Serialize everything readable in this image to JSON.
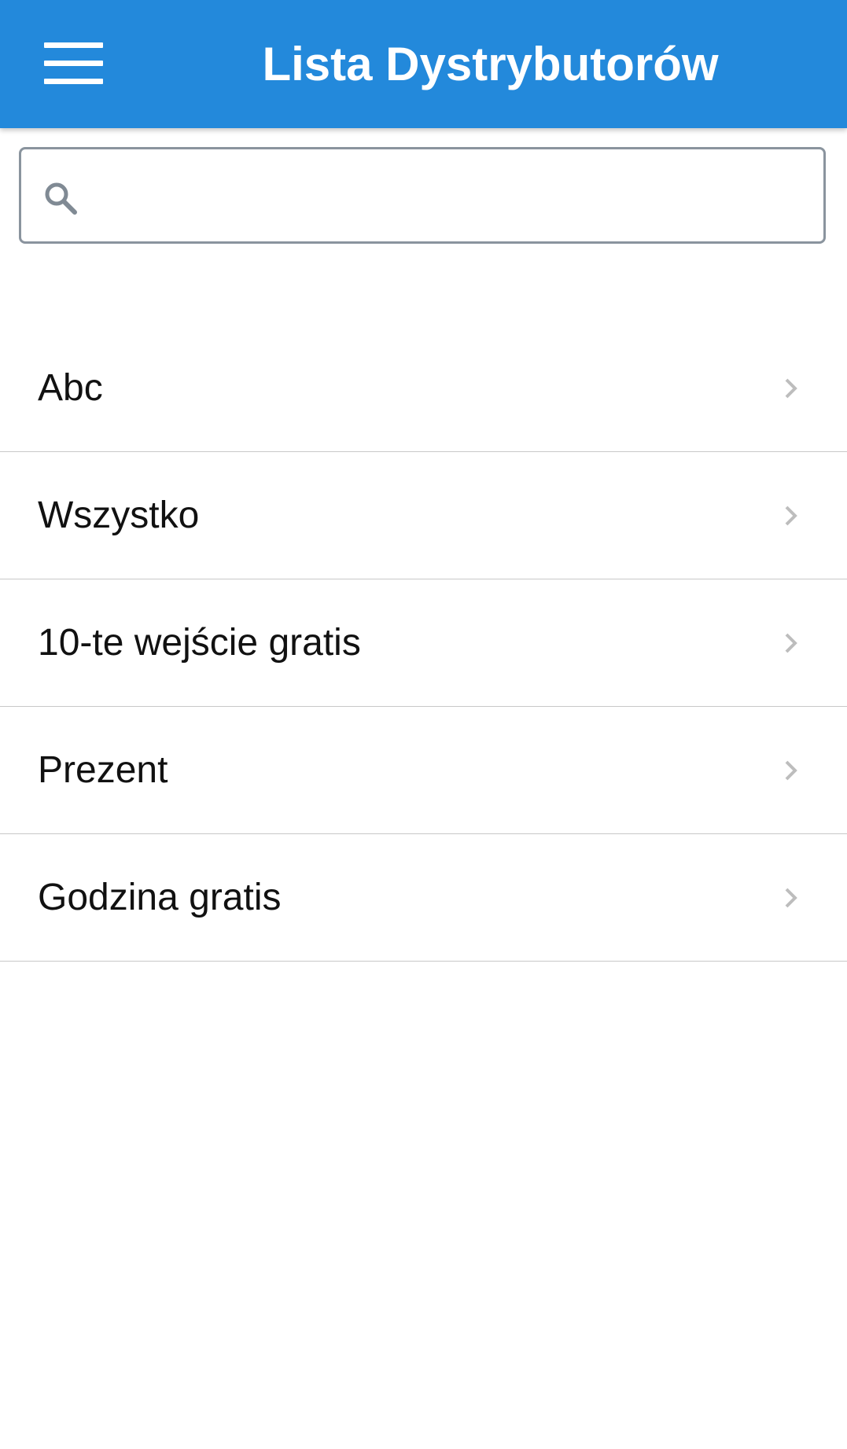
{
  "header": {
    "title": "Lista Dystrybutorów",
    "menu_icon": "hamburger-menu-icon",
    "background_color": "#2389db"
  },
  "search": {
    "value": "",
    "placeholder": "",
    "icon": "search-icon"
  },
  "list": {
    "items": [
      {
        "label": "Abc"
      },
      {
        "label": "Wszystko"
      },
      {
        "label": "10-te wejście gratis"
      },
      {
        "label": "Prezent"
      },
      {
        "label": "Godzina gratis"
      }
    ],
    "item_icon": "chevron-right-icon"
  }
}
